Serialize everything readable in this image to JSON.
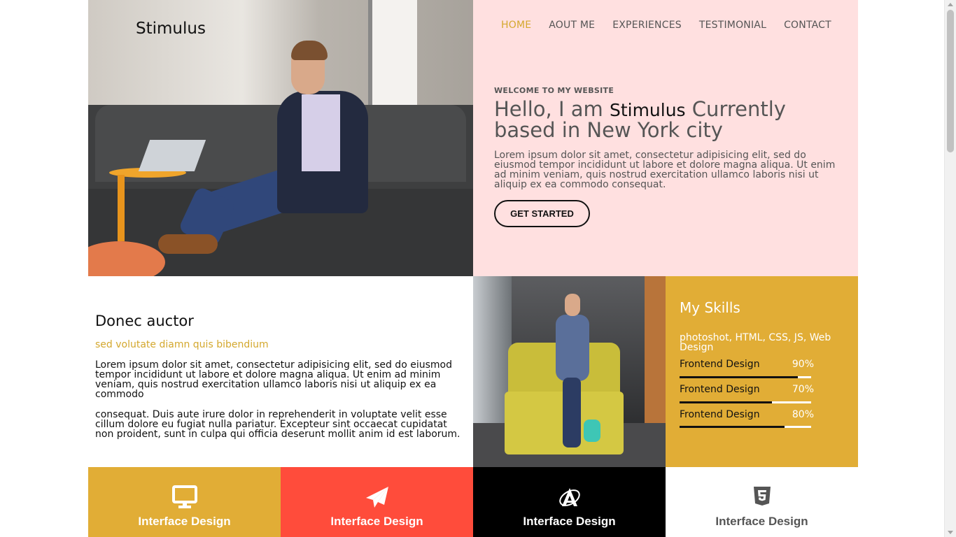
{
  "brand": "Stimulus",
  "nav": {
    "items": [
      "HOME",
      "AOUT ME",
      "EXPERIENCES",
      "TESTIMONIAL",
      "CONTACT"
    ],
    "active": "HOME"
  },
  "hero": {
    "kicker": "WELCOME TO MY WEBSITE",
    "headline_prefix": "Hello, I am ",
    "headline_name": "Stimulus",
    "headline_suffix": " Currently based in New York city",
    "intro": "Lorem ipsum dolor sit amet, consectetur adipisicing elit, sed do eiusmod tempor incididunt ut labore et dolore magna aliqua. Ut enim ad minim veniam, quis nostrud exercitation ullamco laboris nisi ut aliquip ex ea commodo consequat.",
    "cta_label": "GET STARTED"
  },
  "about": {
    "title": "Donec auctor",
    "subtitle": "sed volutate diamn quis bibendium",
    "paragraph1": "Lorem ipsum dolor sit amet, consectetur adipisicing elit, sed do eiusmod tempor incididunt ut labore et dolore magna aliqua. Ut enim ad minim veniam, quis nostrud exercitation ullamco laboris nisi ut aliquip ex ea commodo",
    "paragraph2": "consequat. Duis aute irure dolor in reprehenderit in voluptate velit esse cillum dolore eu fugiat nulla pariatur. Excepteur sint occaecat cupidatat non proident, sunt in culpa qui officia deserunt mollit anim id est laborum."
  },
  "skills": {
    "title": "My Skills",
    "list": "photoshot, HTML, CSS, JS, Web Design",
    "items": [
      {
        "name": "Frontend Design",
        "percent_label": "90%",
        "level": 0.9
      },
      {
        "name": "Frontend Design",
        "percent_label": "70%",
        "level": 0.7
      },
      {
        "name": "Frontend Design",
        "percent_label": "80%",
        "level": 0.8
      }
    ]
  },
  "services": [
    {
      "label": "Interface Design",
      "icon": "monitor-icon"
    },
    {
      "label": "Interface Design",
      "icon": "paper-plane-icon"
    },
    {
      "label": "Interface Design",
      "icon": "angular-icon"
    },
    {
      "label": "Interface Design",
      "icon": "html5-icon"
    }
  ],
  "colors": {
    "accent_gold": "#e1ad36",
    "hero_pink": "#ffe0e0",
    "service_red": "#ff4c3b",
    "service_black": "#000000"
  }
}
